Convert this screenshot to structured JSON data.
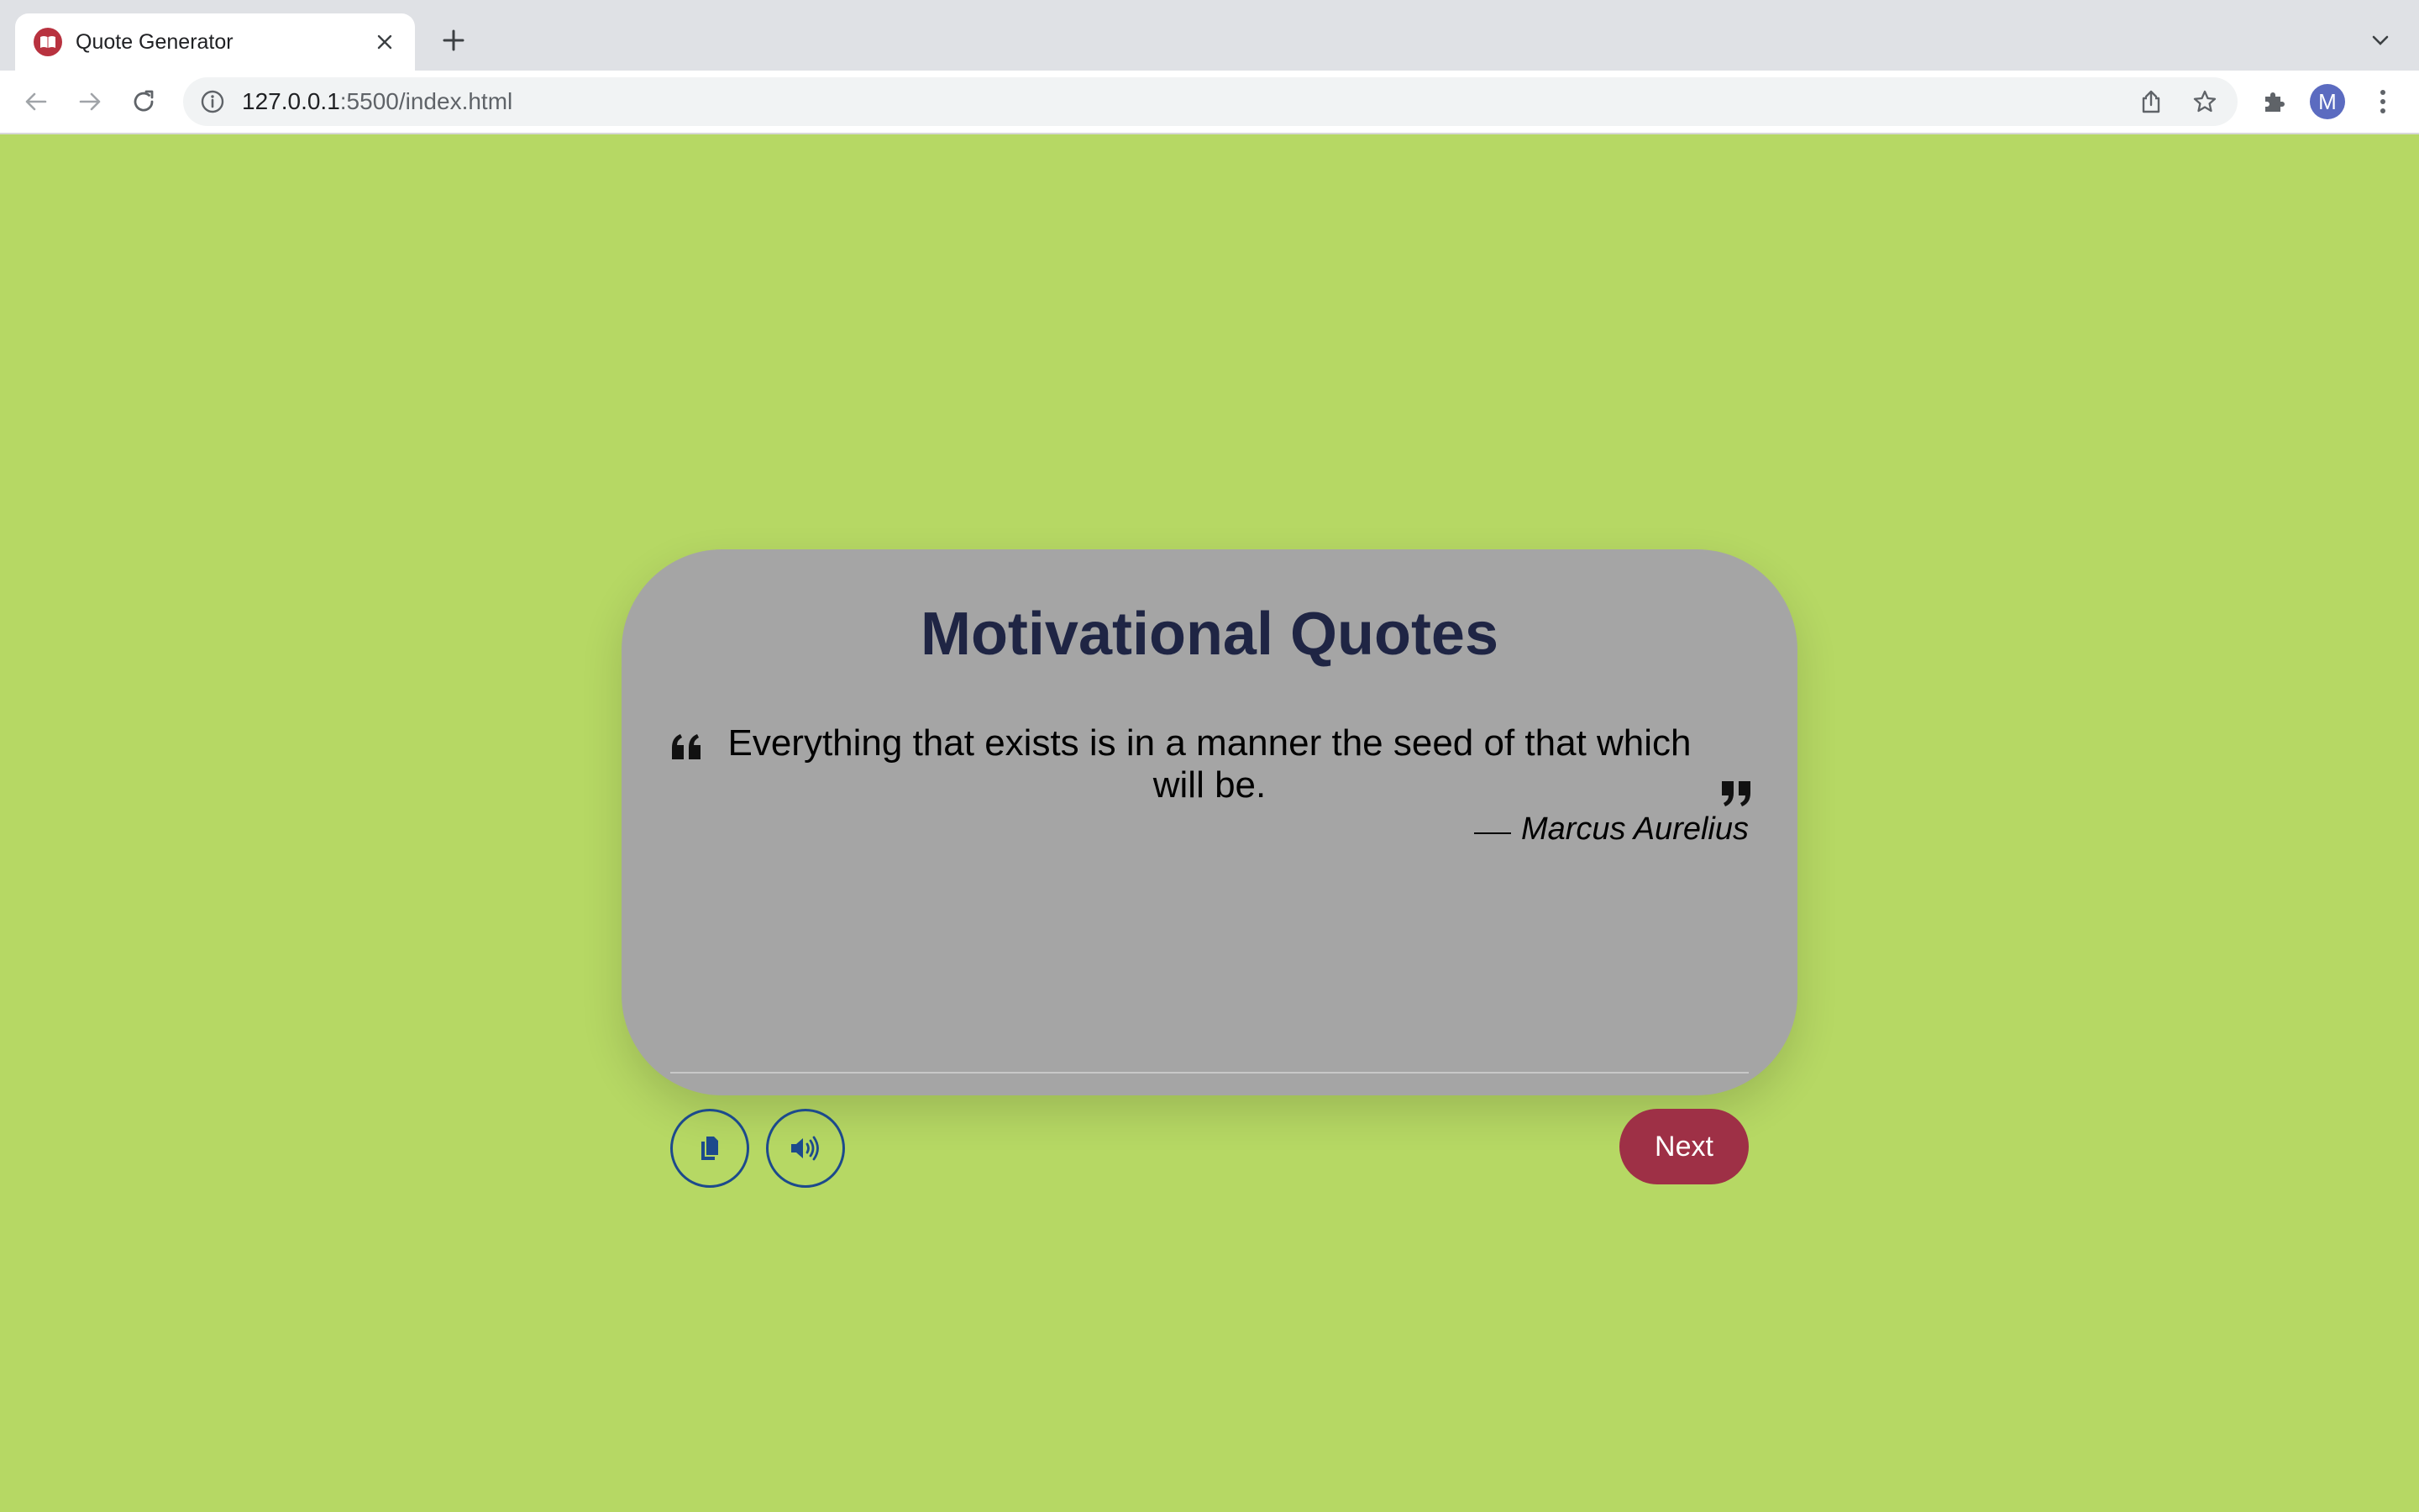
{
  "browser": {
    "tab": {
      "title": "Quote Generator",
      "favicon": "book-icon",
      "favicon_color": "#b8323f"
    },
    "address_bar": {
      "host": "127.0.0.1",
      "path": ":5500/index.html"
    },
    "profile_initial": "M",
    "profile_color": "#5b6bc0"
  },
  "page": {
    "background_color": "#b6d864",
    "card": {
      "background_color": "#a5a5a5",
      "title": "Motivational Quotes",
      "title_color": "#1f2544",
      "quote": "Everything that exists is in a manner the seed of that which will be.",
      "author": "Marcus Aurelius",
      "buttons": {
        "copy_icon": "copy-icon",
        "speak_icon": "speaker-icon",
        "icon_button_border_color": "#1c4a8c",
        "next_label": "Next",
        "next_color": "#9e3046"
      }
    }
  }
}
